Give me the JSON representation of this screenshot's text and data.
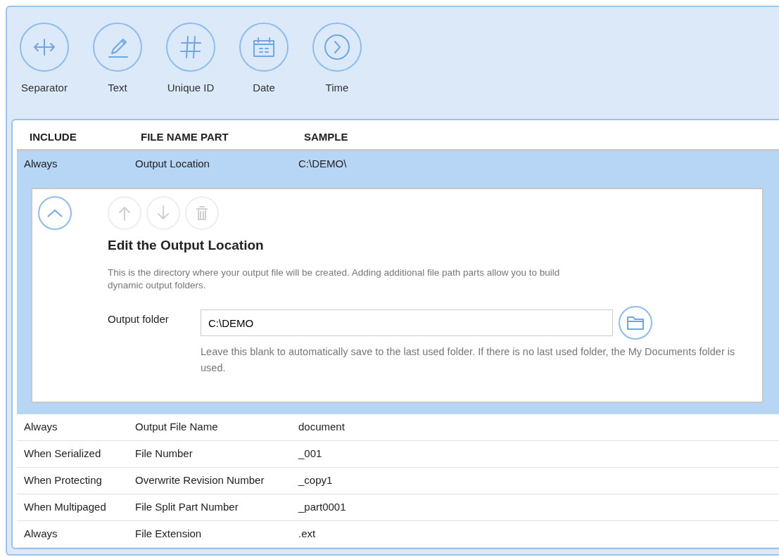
{
  "toolbar": [
    {
      "kind": "separator",
      "label": "Separator"
    },
    {
      "kind": "text",
      "label": "Text"
    },
    {
      "kind": "unique_id",
      "label": "Unique ID"
    },
    {
      "kind": "date",
      "label": "Date"
    },
    {
      "kind": "time",
      "label": "Time"
    }
  ],
  "table": {
    "columns": [
      "INCLUDE",
      "FILE NAME PART",
      "SAMPLE"
    ],
    "rows": [
      {
        "include": "Always",
        "part": "Output Location",
        "sample": "C:\\DEMO\\",
        "selected": true,
        "expanded": true,
        "editor": {
          "actions": [
            {
              "kind": "up",
              "disabled": true
            },
            {
              "kind": "down",
              "disabled": true
            },
            {
              "kind": "delete",
              "disabled": true
            }
          ],
          "title": "Edit the Output Location",
          "description": "This is the directory where your output file will be created. Adding additional file path parts allow you to build dynamic output folders.",
          "field_label": "Output folder",
          "field_value": "C:\\DEMO",
          "hint": "Leave this blank to automatically save to the last used folder. If there is no last used folder, the My Documents folder is used."
        }
      },
      {
        "include": "Always",
        "part": "Output File Name",
        "sample": "document",
        "selected": false
      },
      {
        "include": "When Serialized",
        "part": "File Number",
        "sample": "_001",
        "selected": false
      },
      {
        "include": "When Protecting",
        "part": "Overwrite Revision Number",
        "sample": "_copy1",
        "selected": false
      },
      {
        "include": "When Multipaged",
        "part": "File Split Part Number",
        "sample": "_part0001",
        "selected": false
      },
      {
        "include": "Always",
        "part": "File Extension",
        "sample": ".ext",
        "selected": false
      }
    ]
  }
}
